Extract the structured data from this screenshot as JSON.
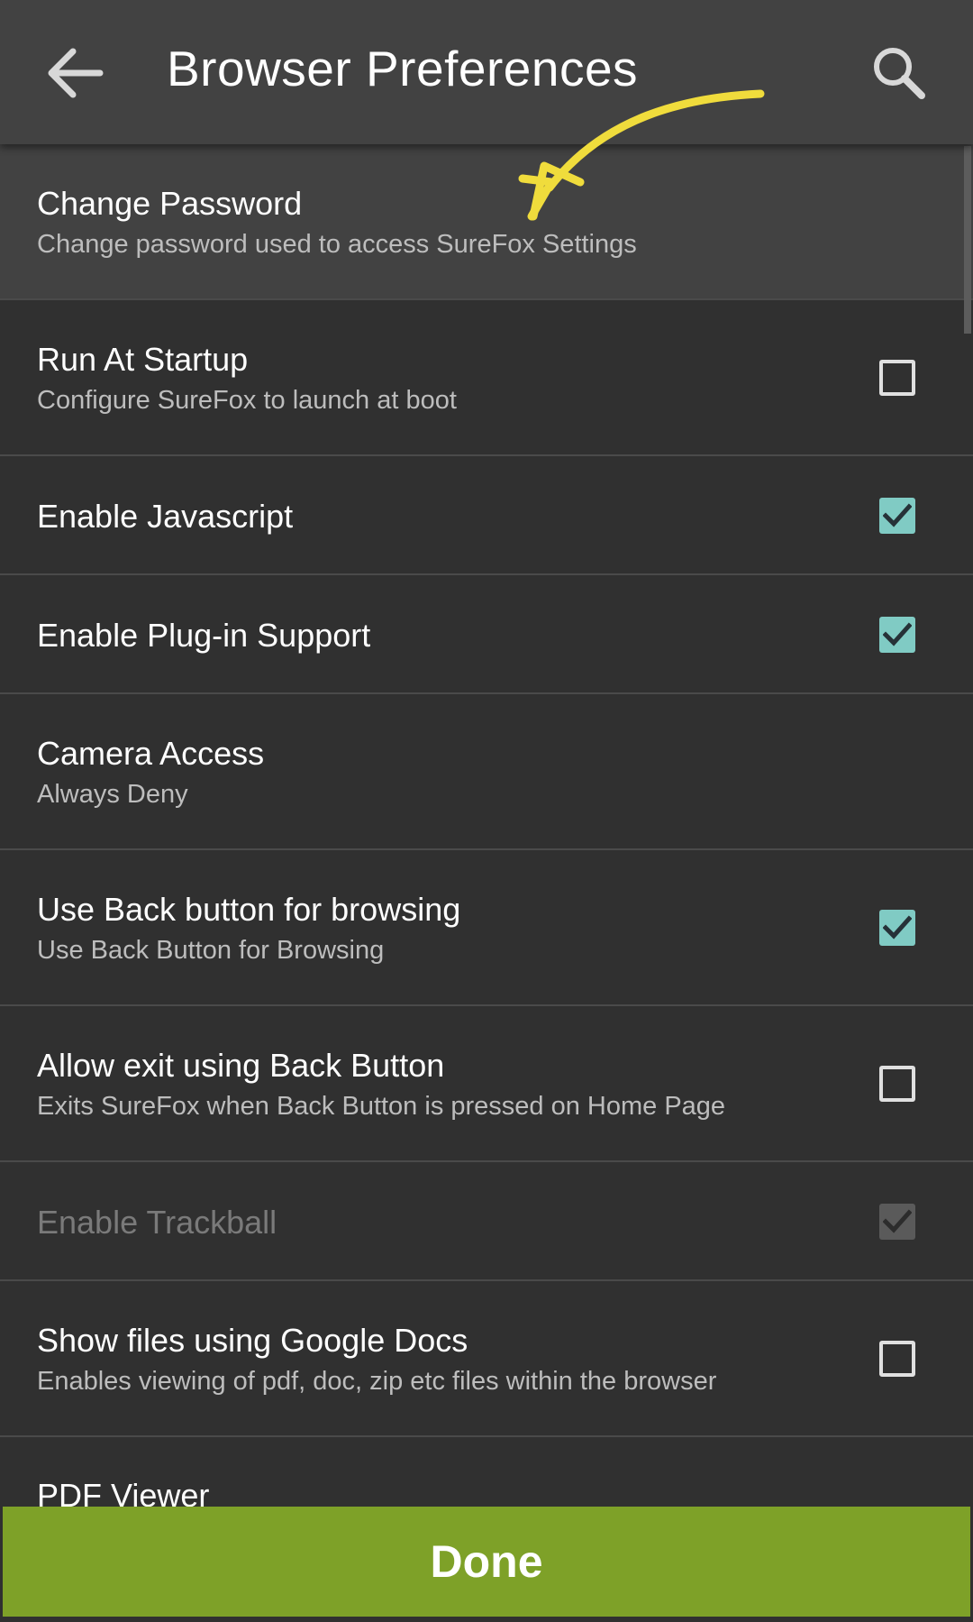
{
  "toolbar": {
    "title": "Browser Preferences",
    "back_icon": "arrow-left-icon",
    "search_icon": "search-icon"
  },
  "colors": {
    "toolbar_bg": "#424242",
    "list_bg": "#303030",
    "checkbox_checked": "#80cbc4",
    "done_bar": "#7ea128",
    "annotation_arrow": "#f0dc3c"
  },
  "preferences": [
    {
      "title": "Change Password",
      "summary": "Change password used to access SureFox Settings"
    },
    {
      "title": "Run At Startup",
      "summary": "Configure SureFox to launch at boot",
      "checked": false
    },
    {
      "title": "Enable Javascript",
      "checked": true
    },
    {
      "title": "Enable Plug-in Support",
      "checked": true
    },
    {
      "title": "Camera Access",
      "summary": "Always Deny"
    },
    {
      "title": "Use Back button for browsing",
      "summary": "Use Back Button for Browsing",
      "checked": true
    },
    {
      "title": "Allow exit using Back Button",
      "summary": "Exits SureFox when Back Button is pressed on Home Page",
      "checked": false
    },
    {
      "title": "Enable Trackball",
      "checked": true,
      "enabled": false
    },
    {
      "title": "Show files using Google Docs",
      "summary": "Enables viewing of pdf, doc, zip etc files within the browser",
      "checked": false
    },
    {
      "title": "PDF Viewer"
    }
  ],
  "footer": {
    "done_label": "Done"
  }
}
